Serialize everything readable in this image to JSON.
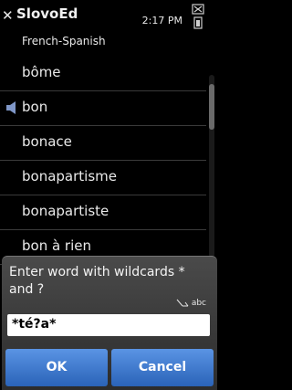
{
  "status": {
    "app_title": "SlovoEd",
    "time": "2:17 PM"
  },
  "dictionary": {
    "subtitle": "French-Spanish"
  },
  "list": {
    "items": [
      {
        "label": "bôme",
        "has_audio": false
      },
      {
        "label": "bon",
        "has_audio": true
      },
      {
        "label": "bonace",
        "has_audio": false
      },
      {
        "label": "bonapartisme",
        "has_audio": false
      },
      {
        "label": "bonapartiste",
        "has_audio": false
      },
      {
        "label": "bon à rien",
        "has_audio": false
      }
    ]
  },
  "dialog": {
    "prompt": "Enter word with wildcards * and ?",
    "input_mode": "abc",
    "input_value": "*té?a*",
    "ok_label": "OK",
    "cancel_label": "Cancel"
  },
  "colors": {
    "button_top": "#5a94e4",
    "button_bottom": "#2a63b8",
    "background": "#000000"
  }
}
